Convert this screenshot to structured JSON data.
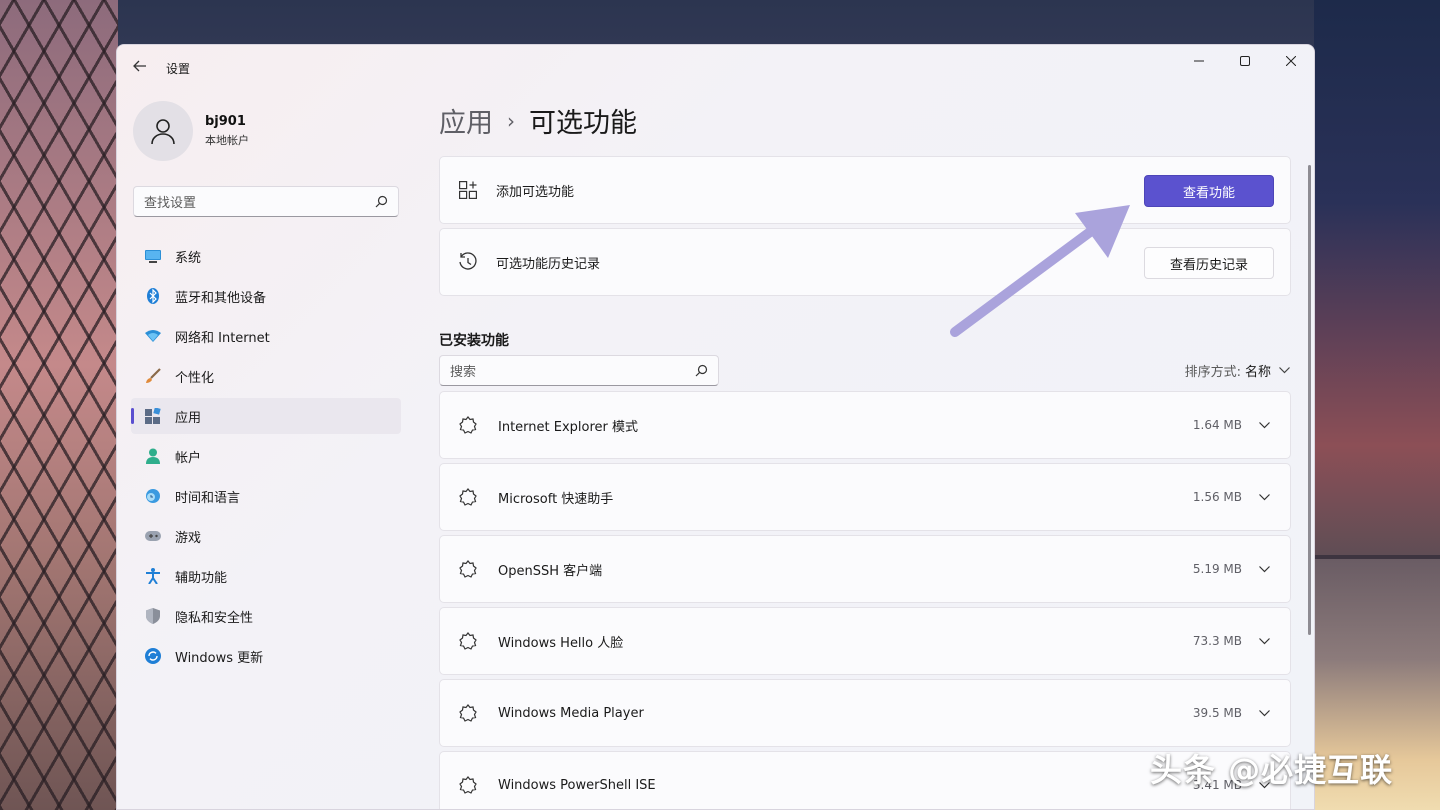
{
  "window": {
    "app_title": "设置"
  },
  "profile": {
    "name": "bj901",
    "account_type": "本地帐户"
  },
  "sidebar": {
    "search_placeholder": "查找设置",
    "items": [
      {
        "label": "系统",
        "icon": "monitor-icon",
        "active": false
      },
      {
        "label": "蓝牙和其他设备",
        "icon": "bluetooth-icon",
        "active": false
      },
      {
        "label": "网络和 Internet",
        "icon": "wifi-icon",
        "active": false
      },
      {
        "label": "个性化",
        "icon": "brush-icon",
        "active": false
      },
      {
        "label": "应用",
        "icon": "apps-icon",
        "active": true
      },
      {
        "label": "帐户",
        "icon": "person-icon",
        "active": false
      },
      {
        "label": "时间和语言",
        "icon": "clock-globe-icon",
        "active": false
      },
      {
        "label": "游戏",
        "icon": "gamepad-icon",
        "active": false
      },
      {
        "label": "辅助功能",
        "icon": "accessibility-icon",
        "active": false
      },
      {
        "label": "隐私和安全性",
        "icon": "shield-icon",
        "active": false
      },
      {
        "label": "Windows 更新",
        "icon": "update-icon",
        "active": false
      }
    ]
  },
  "main": {
    "breadcrumb": {
      "parent": "应用",
      "separator": "›",
      "current": "可选功能"
    },
    "add_feature": {
      "label": "添加可选功能",
      "button": "查看功能"
    },
    "history": {
      "label": "可选功能历史记录",
      "button": "查看历史记录"
    },
    "installed": {
      "title": "已安装功能",
      "search_placeholder": "搜索",
      "sort_label": "排序方式:",
      "sort_value": "名称",
      "features": [
        {
          "name": "Internet Explorer 模式",
          "size": "1.64 MB"
        },
        {
          "name": "Microsoft 快速助手",
          "size": "1.56 MB"
        },
        {
          "name": "OpenSSH 客户端",
          "size": "5.19 MB"
        },
        {
          "name": "Windows Hello 人脸",
          "size": "73.3 MB"
        },
        {
          "name": "Windows Media Player",
          "size": "39.5 MB"
        },
        {
          "name": "Windows PowerShell ISE",
          "size": "3.41 MB"
        }
      ]
    }
  },
  "watermark": "头条 @必捷互联",
  "colors": {
    "accent": "#5b52cf",
    "arrow": "#aaa3dc"
  }
}
